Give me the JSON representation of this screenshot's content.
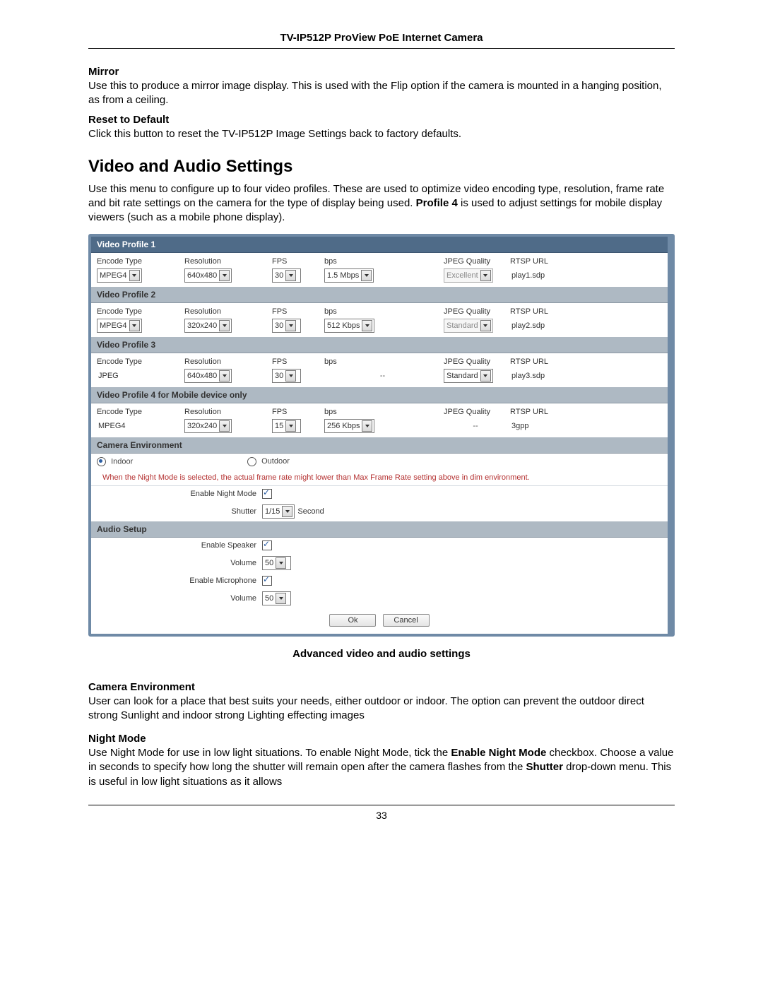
{
  "doc": {
    "header": "TV-IP512P ProView PoE Internet Camera",
    "page_number": "33",
    "mirror_h": "Mirror",
    "mirror_t": "Use this to produce a mirror image display. This is used with the Flip option if the camera is mounted in a hanging position, as from a ceiling.",
    "reset_h": "Reset to Default",
    "reset_t": "Click this button to reset the TV-IP512P Image Settings back to factory defaults.",
    "va_title": "Video and Audio Settings",
    "va_intro_plain": "Use this menu to configure up to four video profiles. These are used to optimize video encoding type, resolution, frame rate and bit rate settings on the camera for the type of display being used. ",
    "va_intro_bold": "Profile 4",
    "va_intro_tail": " is used to adjust settings for mobile display viewers (such as a mobile phone display).",
    "caption": "Advanced video and audio settings",
    "camenv_h": "Camera Environment",
    "camenv_t": "User can look for a place that best suits your needs, either outdoor or indoor. The option can prevent the outdoor direct strong Sunlight and indoor strong Lighting effecting images",
    "night_h": "Night Mode",
    "night_t1": "Use Night Mode for use in low light situations. To enable Night Mode, tick the ",
    "night_b1": "Enable Night Mode",
    "night_t2": " checkbox. Choose a value in seconds to specify how long the shutter will remain open after the camera flashes from the ",
    "night_b2": "Shutter",
    "night_t3": " drop-down menu. This is useful in low light situations as it allows"
  },
  "panel": {
    "colhead": {
      "enc": "Encode Type",
      "res": "Resolution",
      "fps": "FPS",
      "bps": "bps",
      "jq": "JPEG Quality",
      "url": "RTSP URL"
    },
    "profiles": [
      {
        "title": "Video Profile 1",
        "enc": "MPEG4",
        "enc_sel": true,
        "res": "640x480",
        "fps": "30",
        "bps": "1.5 Mbps",
        "bps_sel": true,
        "jq": "Excellent",
        "jq_disabled": true,
        "url": "play1.sdp"
      },
      {
        "title": "Video Profile 2",
        "enc": "MPEG4",
        "enc_sel": true,
        "res": "320x240",
        "fps": "30",
        "bps": "512 Kbps",
        "bps_sel": true,
        "jq": "Standard",
        "jq_disabled": true,
        "url": "play2.sdp"
      },
      {
        "title": "Video Profile 3",
        "enc": "JPEG",
        "enc_sel": false,
        "res": "640x480",
        "fps": "30",
        "bps": "--",
        "bps_sel": false,
        "jq": "Standard",
        "jq_disabled": false,
        "url": "play3.sdp"
      },
      {
        "title": "Video Profile 4 for Mobile device only",
        "enc": "MPEG4",
        "enc_sel": false,
        "res": "320x240",
        "fps": "15",
        "bps": "256 Kbps",
        "bps_sel": true,
        "jq": "--",
        "jq_disabled": false,
        "url": "3gpp"
      }
    ],
    "env": {
      "title": "Camera Environment",
      "indoor": "Indoor",
      "outdoor": "Outdoor",
      "warn": "When the Night Mode is selected, the actual frame rate might lower than Max Frame Rate setting above in dim environment.",
      "night_lbl": "Enable Night Mode",
      "shutter_lbl": "Shutter",
      "shutter_val": "1/15",
      "shutter_unit": "Second"
    },
    "audio": {
      "title": "Audio Setup",
      "spk_lbl": "Enable Speaker",
      "vol_lbl": "Volume",
      "vol1": "50",
      "mic_lbl": "Enable Microphone",
      "vol2": "50"
    },
    "buttons": {
      "ok": "Ok",
      "cancel": "Cancel"
    }
  }
}
